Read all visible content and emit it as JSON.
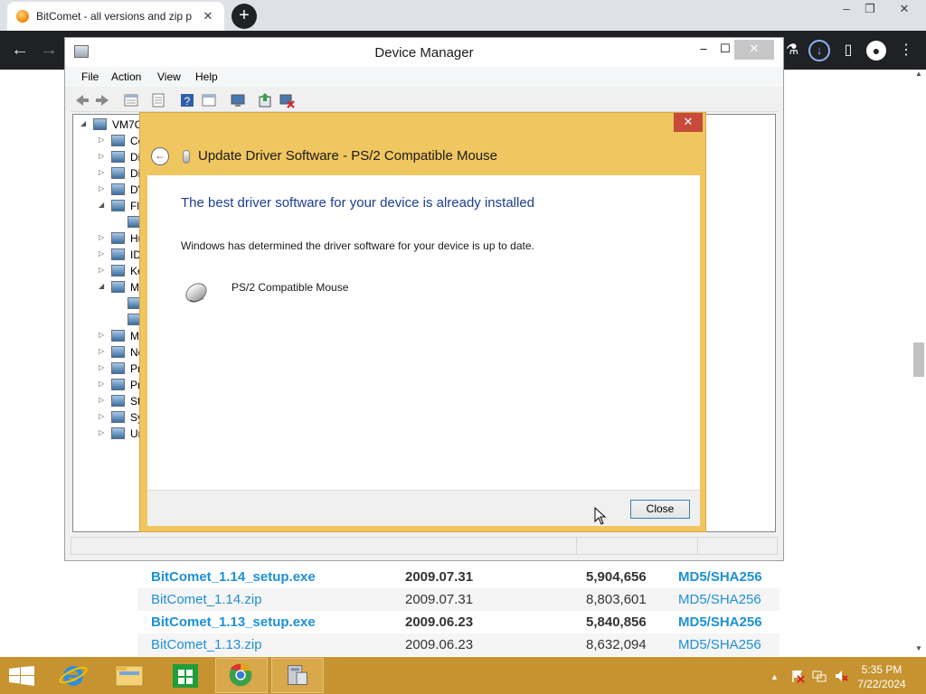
{
  "browser": {
    "tab_title": "BitComet - all versions and zip p",
    "tab_close": "✕",
    "new_tab": "+",
    "back": "←",
    "forward": "→",
    "window_minimize": "–",
    "window_restore": "❐",
    "window_close": "✕",
    "download_icon": "↓",
    "sidebar_icon": "▯",
    "profile_icon": "●",
    "menu_icon": "⋮",
    "extension_icon": "⚗"
  },
  "downloads": [
    {
      "file": "BitComet_1.14_setup.exe",
      "date": "2009.07.31",
      "size": "5,904,656",
      "hash": "MD5/SHA256",
      "bold": true
    },
    {
      "file": "BitComet_1.14.zip",
      "date": "2009.07.31",
      "size": "8,803,601",
      "hash": "MD5/SHA256",
      "bold": false
    },
    {
      "file": "BitComet_1.13_setup.exe",
      "date": "2009.06.23",
      "size": "5,840,856",
      "hash": "MD5/SHA256",
      "bold": true
    },
    {
      "file": "BitComet_1.13.zip",
      "date": "2009.06.23",
      "size": "8,632,094",
      "hash": "MD5/SHA256",
      "bold": false
    }
  ],
  "device_manager": {
    "title": "Device Manager",
    "minimize": "–",
    "maximize": "☐",
    "close": "✕",
    "menus": [
      "File",
      "Action",
      "View",
      "Help"
    ],
    "tree": [
      {
        "label": "VM7C",
        "exp": "◢"
      },
      {
        "label": "Co",
        "exp": "▷"
      },
      {
        "label": "Di",
        "exp": "▷"
      },
      {
        "label": "Di",
        "exp": "▷"
      },
      {
        "label": "DV",
        "exp": "▷"
      },
      {
        "label": "Fl",
        "exp": "◢"
      },
      {
        "label": "",
        "exp": ""
      },
      {
        "label": "Hu",
        "exp": "▷"
      },
      {
        "label": "ID",
        "exp": "▷"
      },
      {
        "label": "Ke",
        "exp": "▷"
      },
      {
        "label": "M",
        "exp": "◢"
      },
      {
        "label": "",
        "exp": ""
      },
      {
        "label": "",
        "exp": ""
      },
      {
        "label": "M",
        "exp": "▷"
      },
      {
        "label": "Ne",
        "exp": "▷"
      },
      {
        "label": "Pr",
        "exp": "▷"
      },
      {
        "label": "Pr",
        "exp": "▷"
      },
      {
        "label": "St",
        "exp": "▷"
      },
      {
        "label": "Sy",
        "exp": "▷"
      },
      {
        "label": "Ur",
        "exp": "▷"
      }
    ]
  },
  "dialog": {
    "title": "Update Driver Software - PS/2 Compatible Mouse",
    "close_glyph": "✕",
    "back_glyph": "←",
    "heading": "The best driver software for your device is already installed",
    "message": "Windows has determined the driver software for your device is up to date.",
    "device_name": "PS/2 Compatible Mouse",
    "close_button": "Close"
  },
  "taskbar": {
    "time": "5:35 PM",
    "date": "7/22/2024",
    "tray_up": "▲"
  },
  "colors": {
    "dialog_frame": "#f0c660",
    "taskbar": "#c69330",
    "link": "#1e90d6",
    "heading_blue": "#1c3d8f"
  }
}
